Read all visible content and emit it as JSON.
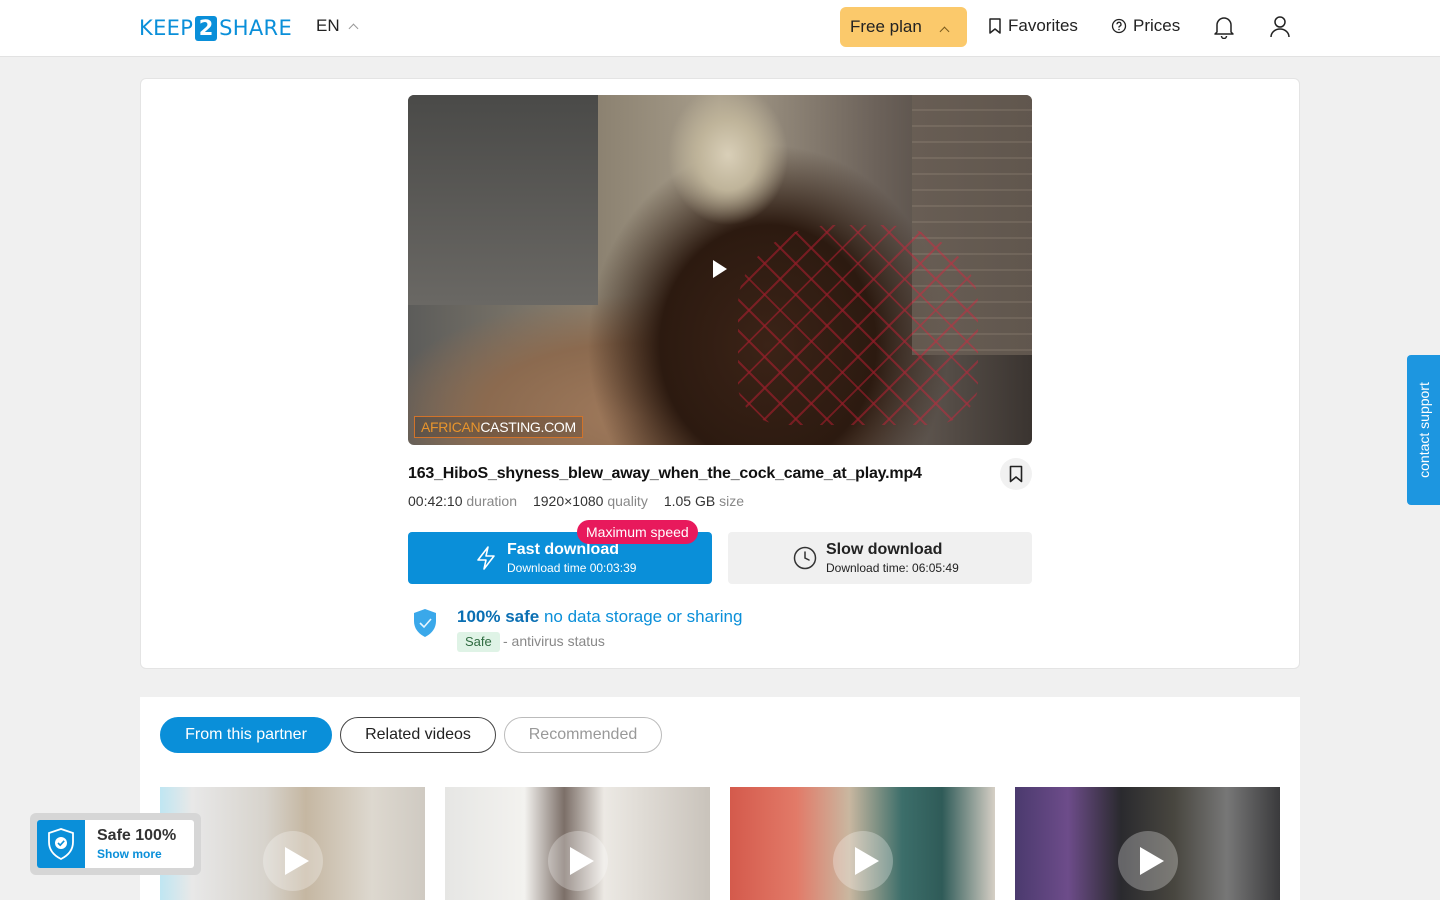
{
  "header": {
    "logo_left": "KEEP",
    "logo_mid": "2",
    "logo_right": "SHARE",
    "language": "EN",
    "plan_label": "Free plan",
    "favorites_label": "Favorites",
    "prices_label": "Prices"
  },
  "video": {
    "watermark_part1": "AFRICAN",
    "watermark_part2": "CASTING.COM",
    "filename": "163_HiboS_shyness_blew_away_when_the_cock_came_at_play.mp4",
    "duration": "00:42:10",
    "duration_label": "duration",
    "resolution": "1920×1080",
    "resolution_label": "quality",
    "size": "1.05 GB",
    "size_label": "size"
  },
  "download": {
    "fast_title": "Fast download",
    "fast_time": "Download time 00:03:39",
    "max_speed_badge": "Maximum speed",
    "slow_title": "Slow download",
    "slow_time": "Download time: 06:05:49"
  },
  "safety": {
    "title_bold": "100% safe",
    "title_rest": " no data storage or sharing",
    "tag": "Safe",
    "status": "- antivirus status"
  },
  "related": {
    "tabs": [
      "From this partner",
      "Related videos",
      "Recommended"
    ]
  },
  "support_label": "contact support",
  "safe_widget": {
    "title": "Safe 100%",
    "link": "Show more"
  },
  "colors": {
    "accent": "#0a8fd9",
    "plan": "#fbc96b",
    "badge": "#e8195c"
  }
}
